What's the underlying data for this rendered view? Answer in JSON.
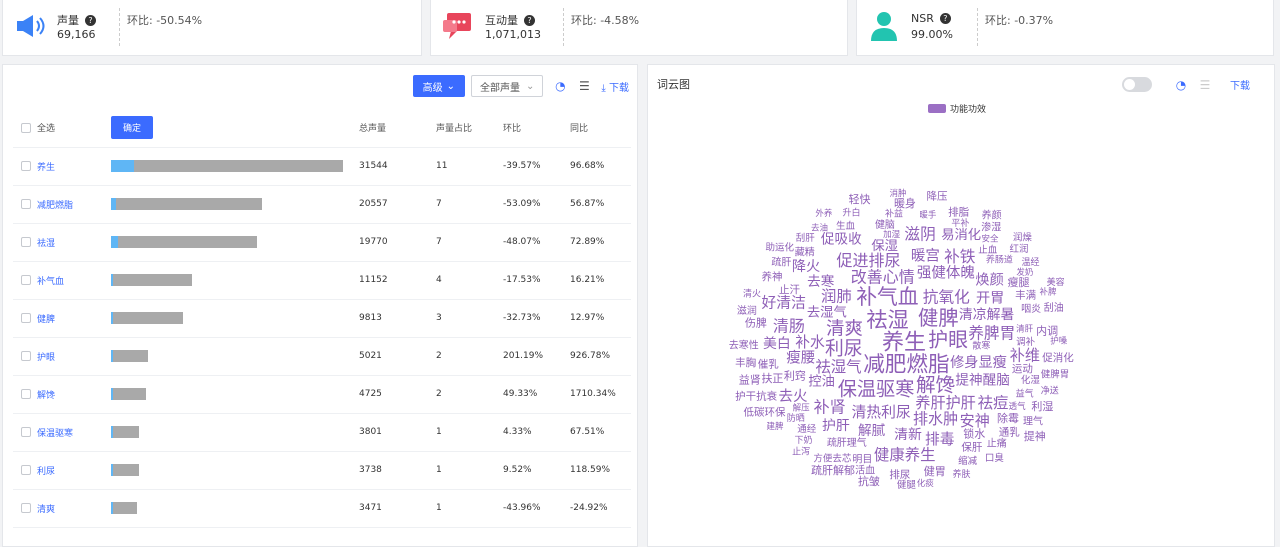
{
  "stats": [
    {
      "label": "声量",
      "value": "69,166",
      "ratio": "环比: -50.54%"
    },
    {
      "label": "互动量",
      "value": "1,071,013",
      "ratio": "环比: -4.58%"
    },
    {
      "label": "NSR",
      "value": "99.00%",
      "ratio": "环比: -0.37%"
    }
  ],
  "toolbar": {
    "advanced": "高级",
    "scope": "全部声量",
    "download": "下载"
  },
  "table": {
    "select_all": "全选",
    "confirm": "确定",
    "headers": [
      "总声量",
      "声量占比",
      "环比",
      "同比"
    ],
    "rows": [
      {
        "name": "养生",
        "total": "31544",
        "share": "11",
        "mom": "-39.57%",
        "yoy": "96.68%",
        "bar": 1.0,
        "hl": 0.1
      },
      {
        "name": "减肥燃脂",
        "total": "20557",
        "share": "7",
        "mom": "-53.09%",
        "yoy": "56.87%",
        "bar": 0.65,
        "hl": 0.02
      },
      {
        "name": "祛湿",
        "total": "19770",
        "share": "7",
        "mom": "-48.07%",
        "yoy": "72.89%",
        "bar": 0.63,
        "hl": 0.03
      },
      {
        "name": "补气血",
        "total": "11152",
        "share": "4",
        "mom": "-17.53%",
        "yoy": "16.21%",
        "bar": 0.35,
        "hl": 0.005
      },
      {
        "name": "健脾",
        "total": "9813",
        "share": "3",
        "mom": "-32.73%",
        "yoy": "12.97%",
        "bar": 0.31,
        "hl": 0.01
      },
      {
        "name": "护眼",
        "total": "5021",
        "share": "2",
        "mom": "201.19%",
        "yoy": "926.78%",
        "bar": 0.16,
        "hl": 0.0
      },
      {
        "name": "解馋",
        "total": "4725",
        "share": "2",
        "mom": "49.33%",
        "yoy": "1710.34%",
        "bar": 0.15,
        "hl": 0.0
      },
      {
        "name": "保温驱寒",
        "total": "3801",
        "share": "1",
        "mom": "4.33%",
        "yoy": "67.51%",
        "bar": 0.12,
        "hl": 0.0
      },
      {
        "name": "利尿",
        "total": "3738",
        "share": "1",
        "mom": "9.52%",
        "yoy": "118.59%",
        "bar": 0.12,
        "hl": 0.0
      },
      {
        "name": "清爽",
        "total": "3471",
        "share": "1",
        "mom": "-43.96%",
        "yoy": "-24.92%",
        "bar": 0.11,
        "hl": 0.01
      }
    ]
  },
  "wordcloud": {
    "title": "词云图",
    "download": "下载",
    "legend": "功能功效",
    "color": "#8e5fb7",
    "big": [
      "养生",
      "减肥燃脂",
      "祛湿",
      "补气血",
      "健脾",
      "护眼",
      "解馋",
      "保温驱寒",
      "利尿",
      "清爽"
    ],
    "medium": [
      "改善心情",
      "抗氧化",
      "祛湿气",
      "养肝护肝",
      "清热利尿",
      "强健体魄",
      "修身显瘦",
      "清凉解暑",
      "提神醒脑",
      "去湿气",
      "促进排尿",
      "养脾胃",
      "润肺",
      "排水肿",
      "补水",
      "暖宫",
      "开胃",
      "清新",
      "解腻",
      "控油",
      "补肾",
      "补铁",
      "祛痘",
      "安神",
      "排毒",
      "瘦腰",
      "焕颜",
      "护肝",
      "去寒",
      "保湿",
      "清肠",
      "滋阴",
      "健康养生",
      "补维",
      "好清洁",
      "去火",
      "降火",
      "美白",
      "促吸收",
      "易消化"
    ],
    "small": [
      "利窍",
      "运动",
      "疏肝理气",
      "调补",
      "散寒",
      "加湿",
      "锁水",
      "止汗",
      "健脑",
      "止血",
      "养肠道",
      "清肝",
      "瘦腿",
      "丰满",
      "咽炎",
      "化湿",
      "益气",
      "解压",
      "除霉",
      "保肝",
      "明目",
      "通经",
      "防晒",
      "透气",
      "扶正",
      "催乳",
      "藏精",
      "生血",
      "补益",
      "暖手",
      "内调",
      "通乳",
      "止痛",
      "缩减",
      "平补",
      "安全",
      "健胃",
      "排尿",
      "活血",
      "方便去芯",
      "下奶",
      "发奶",
      "伤脾",
      "养神",
      "疏肝",
      "刮肝",
      "升白",
      "去油",
      "暖身",
      "排脂",
      "渗湿",
      "红润",
      "温经",
      "补脾",
      "疏肝解郁",
      "促消化",
      "刮油",
      "健脾胃",
      "净送",
      "护嗓",
      "利湿",
      "低碳环保",
      "理气",
      "口臭",
      "养肤",
      "化痰",
      "抗皱",
      "护干抗衰",
      "去寒性",
      "健腿",
      "止泻",
      "建脾",
      "益肾",
      "丰胸",
      "滋润",
      "助运化",
      "清火",
      "外养",
      "轻快",
      "降压",
      "养颜",
      "润燥",
      "美容",
      "消肿",
      "提神"
    ]
  }
}
